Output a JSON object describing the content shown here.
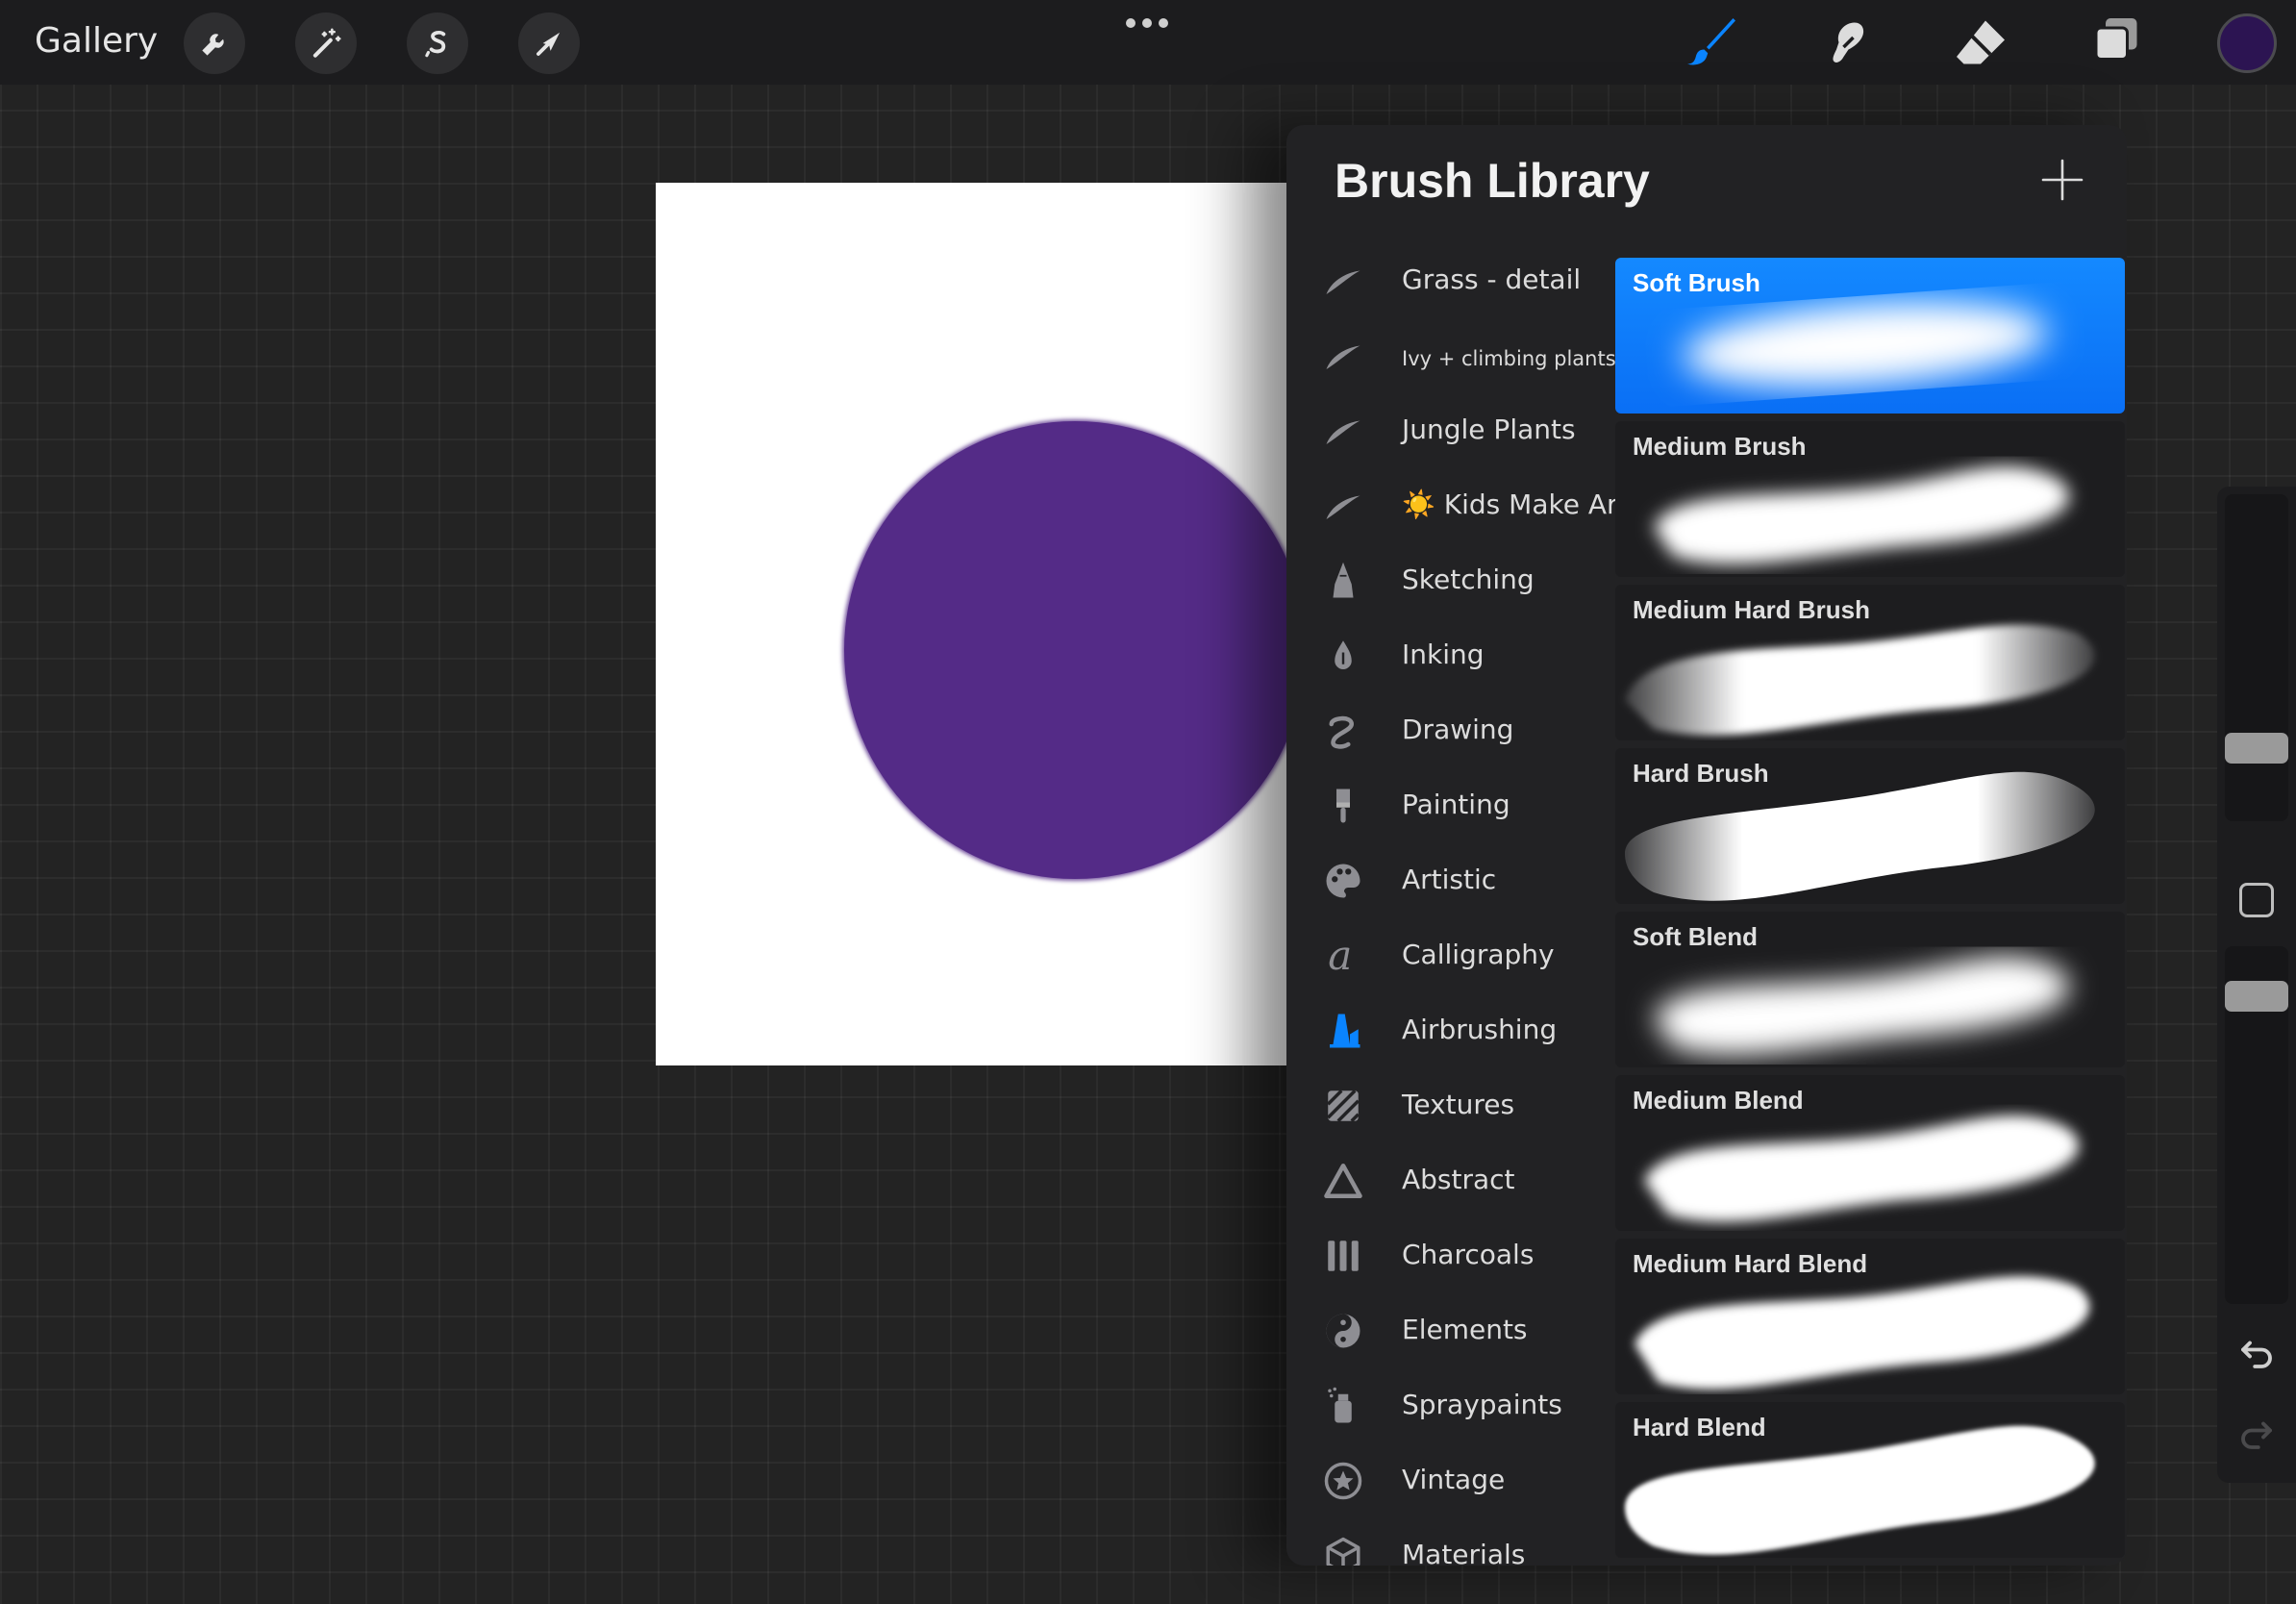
{
  "topbar": {
    "gallery_label": "Gallery",
    "left_tools": [
      "wrench-icon",
      "magic-wand-icon",
      "selection-s-icon",
      "arrow-transform-icon"
    ],
    "right_tools": [
      "brush-icon",
      "smudge-icon",
      "eraser-icon",
      "layers-icon"
    ],
    "active_tool": "brush",
    "current_color": "#2c1452"
  },
  "canvas": {
    "background": "#ffffff",
    "paint_color": "#542b87"
  },
  "brush_library": {
    "title": "Brush Library",
    "brush_sets": [
      {
        "label": "Grass - detail",
        "icon": "stroke-icon"
      },
      {
        "label": "Ivy + climbing plants",
        "icon": "stroke-icon"
      },
      {
        "label": "Jungle Plants",
        "icon": "stroke-icon"
      },
      {
        "label": "☀️ Kids Make Art!",
        "icon": "stroke-icon"
      },
      {
        "label": "Sketching",
        "icon": "pencil-icon"
      },
      {
        "label": "Inking",
        "icon": "ink-drop-icon"
      },
      {
        "label": "Drawing",
        "icon": "squiggle-icon"
      },
      {
        "label": "Painting",
        "icon": "paintbrush-icon"
      },
      {
        "label": "Artistic",
        "icon": "palette-icon"
      },
      {
        "label": "Calligraphy",
        "icon": "calligraphy-icon"
      },
      {
        "label": "Airbrushing",
        "icon": "airbrush-icon"
      },
      {
        "label": "Textures",
        "icon": "texture-icon"
      },
      {
        "label": "Abstract",
        "icon": "triangle-icon"
      },
      {
        "label": "Charcoals",
        "icon": "charcoal-icon"
      },
      {
        "label": "Elements",
        "icon": "yin-yang-icon"
      },
      {
        "label": "Spraypaints",
        "icon": "spray-can-icon"
      },
      {
        "label": "Vintage",
        "icon": "star-badge-icon"
      },
      {
        "label": "Materials",
        "icon": "cube-icon"
      }
    ],
    "selected_set": "Airbrushing",
    "brushes": [
      {
        "name": "Soft Brush",
        "selected": true
      },
      {
        "name": "Medium Brush",
        "selected": false
      },
      {
        "name": "Medium Hard Brush",
        "selected": false
      },
      {
        "name": "Hard Brush",
        "selected": false
      },
      {
        "name": "Soft Blend",
        "selected": false
      },
      {
        "name": "Medium Blend",
        "selected": false
      },
      {
        "name": "Medium Hard Blend",
        "selected": false
      },
      {
        "name": "Hard Blend",
        "selected": false
      }
    ]
  },
  "colors": {
    "accent": "#0a84ff",
    "panel_bg": "#222224",
    "topbar_bg": "#1c1c1e"
  }
}
